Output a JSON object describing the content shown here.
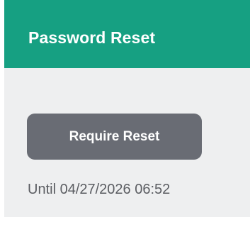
{
  "header": {
    "title": "Password Reset",
    "color": "#16a082"
  },
  "actions": {
    "require_reset_label": "Require Reset",
    "button_color": "#696c74"
  },
  "status": {
    "until_text": "Until 04/27/2026 06:52"
  }
}
